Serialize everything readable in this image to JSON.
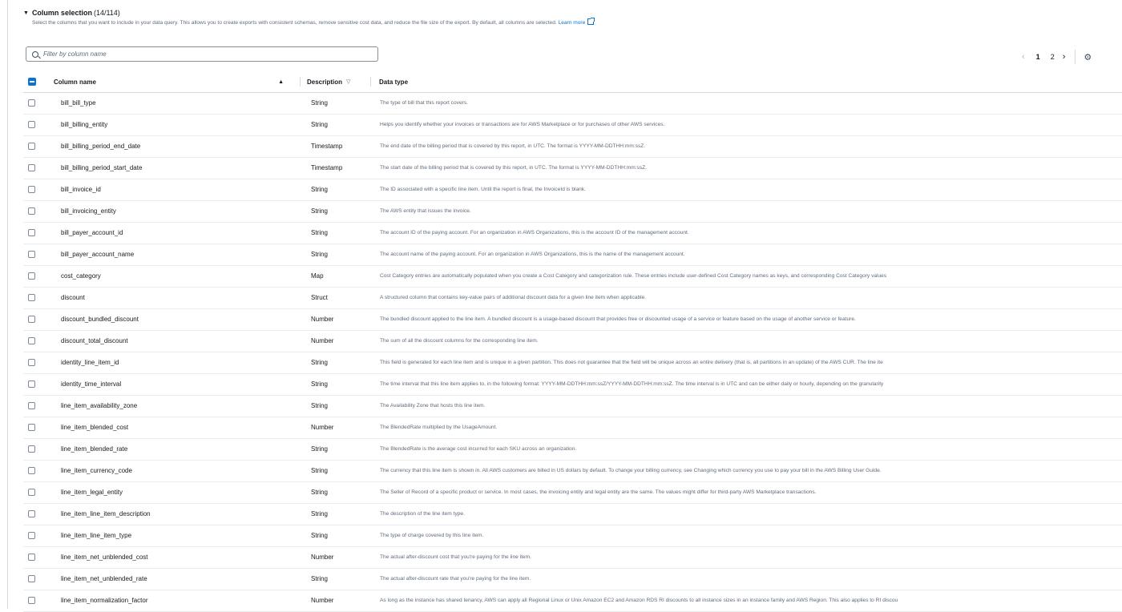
{
  "section": {
    "title": "Column selection",
    "count": "(14/114)",
    "description": "Select the columns that you want to include in your data query. This allows you to create exports with consistent schemas, remove sensitive cost data, and reduce the file size of the export. By default, all columns are selected.",
    "learn_more": "Learn more"
  },
  "search": {
    "placeholder": "Filter by column name"
  },
  "pagination": {
    "page1": "1",
    "page2": "2"
  },
  "table": {
    "headers": {
      "name": "Column name",
      "type": "Description",
      "desc": "Data type"
    },
    "rows": [
      {
        "name": "bill_bill_type",
        "type": "String",
        "desc": "The type of bill that this report covers."
      },
      {
        "name": "bill_billing_entity",
        "type": "String",
        "desc": "Helps you identify whether your invoices or transactions are for AWS Marketplace or for purchases of other AWS services."
      },
      {
        "name": "bill_billing_period_end_date",
        "type": "Timestamp",
        "desc": "The end date of the billing period that is covered by this report, in UTC. The format is YYYY-MM-DDTHH:mm:ssZ."
      },
      {
        "name": "bill_billing_period_start_date",
        "type": "Timestamp",
        "desc": "The start date of the billing period that is covered by this report, in UTC. The format is YYYY-MM-DDTHH:mm:ssZ."
      },
      {
        "name": "bill_invoice_id",
        "type": "String",
        "desc": "The ID associated with a specific line item. Until the report is final, the InvoiceId is blank."
      },
      {
        "name": "bill_invoicing_entity",
        "type": "String",
        "desc": "The AWS entity that issues the invoice."
      },
      {
        "name": "bill_payer_account_id",
        "type": "String",
        "desc": "The account ID of the paying account. For an organization in AWS Organizations, this is the account ID of the management account."
      },
      {
        "name": "bill_payer_account_name",
        "type": "String",
        "desc": "The account name of the paying account. For an organization in AWS Organizations, this is the name of the management account."
      },
      {
        "name": "cost_category",
        "type": "Map",
        "desc": "Cost Category entries are automatically populated when you create a Cost Category and categorization rule. These entries include user-defined Cost Category names as keys, and corresponding Cost Category values"
      },
      {
        "name": "discount",
        "type": "Struct",
        "desc": "A structured column that contains key-value pairs of additional discount data for a given line item when applicable."
      },
      {
        "name": "discount_bundled_discount",
        "type": "Number",
        "desc": "The bundled discount applied to the line item. A bundled discount is a usage-based discount that provides free or discounted usage of a service or feature based on the usage of another service or feature."
      },
      {
        "name": "discount_total_discount",
        "type": "Number",
        "desc": "The sum of all the discount columns for the corresponding line item."
      },
      {
        "name": "identity_line_item_id",
        "type": "String",
        "desc": "This field is generated for each line item and is unique in a given partition. This does not guarantee that the field will be unique across an entire delivery (that is, all partitions in an update) of the AWS CUR. The line ite"
      },
      {
        "name": "identity_time_interval",
        "type": "String",
        "desc": "The time interval that this line item applies to, in the following format: YYYY-MM-DDTHH:mm:ssZ/YYYY-MM-DDTHH:mm:ssZ. The time interval is in UTC and can be either daily or hourly, depending on the granularity"
      },
      {
        "name": "line_item_availability_zone",
        "type": "String",
        "desc": "The Availability Zone that hosts this line item."
      },
      {
        "name": "line_item_blended_cost",
        "type": "Number",
        "desc": "The BlendedRate multiplied by the UsageAmount."
      },
      {
        "name": "line_item_blended_rate",
        "type": "String",
        "desc": "The BlendedRate is the average cost incurred for each SKU across an organization."
      },
      {
        "name": "line_item_currency_code",
        "type": "String",
        "desc": "The currency that this line item is shown in. All AWS customers are billed in US dollars by default. To change your billing currency, see Changing which currency you use to pay your bill in the AWS Billing User Guide."
      },
      {
        "name": "line_item_legal_entity",
        "type": "String",
        "desc": "The Seller of Record of a specific product or service. In most cases, the invoicing entity and legal entity are the same. The values might differ for third-party AWS Marketplace transactions."
      },
      {
        "name": "line_item_line_item_description",
        "type": "String",
        "desc": "The description of the line item type."
      },
      {
        "name": "line_item_line_item_type",
        "type": "String",
        "desc": "The type of charge covered by this line item."
      },
      {
        "name": "line_item_net_unblended_cost",
        "type": "Number",
        "desc": "The actual after-discount cost that you're paying for the line item."
      },
      {
        "name": "line_item_net_unblended_rate",
        "type": "String",
        "desc": "The actual after-discount rate that you're paying for the line item."
      },
      {
        "name": "line_item_normalization_factor",
        "type": "Number",
        "desc": "As long as the instance has shared tenancy, AWS can apply all Regional Linux or Unix Amazon EC2 and Amazon RDS RI discounts to all instance sizes in an instance family and AWS Region. This also applies to RI discou"
      }
    ]
  }
}
